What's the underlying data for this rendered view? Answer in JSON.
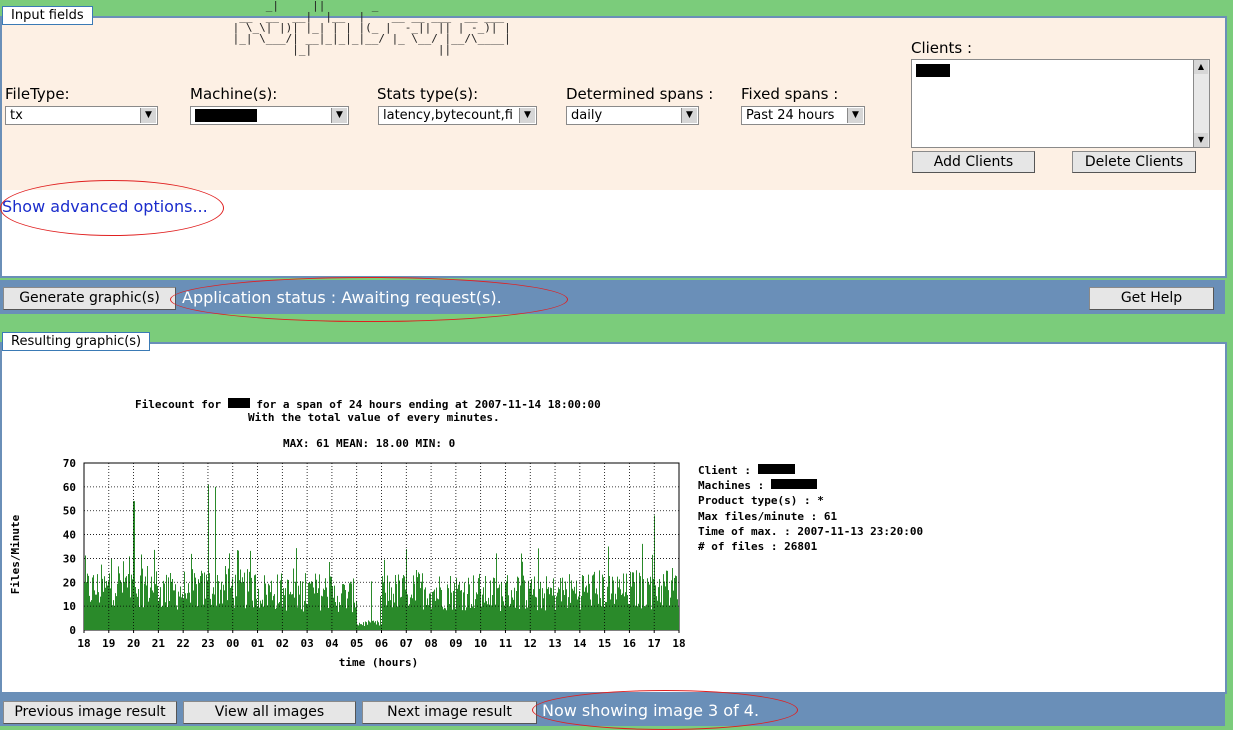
{
  "input_panel": {
    "legend": "Input fields",
    "ascii_banner": "      _|     ||       _      \n  __  __  __|  |__  |    __ __ ___  __ ___\n | \\_\\| |)| |_| | | |(_ |  -_|| || | -_)| |\n |_| \\___/| __|_|_|_|__/ |_ \\__/ |__/\\____|\n          |_|                   ||\n",
    "filetype": {
      "label": "FileType:",
      "value": "tx"
    },
    "machines": {
      "label": "Machine(s):"
    },
    "stats_type": {
      "label": "Stats type(s):",
      "value": "latency,bytecount,fi"
    },
    "determined_spans": {
      "label": "Determined spans :",
      "value": "daily"
    },
    "fixed_spans": {
      "label": "Fixed spans :",
      "value": "Past 24 hours"
    },
    "clients": {
      "label": "Clients :",
      "add_label": "Add Clients",
      "delete_label": "Delete Clients"
    }
  },
  "advanced": {
    "link_text": "Show advanced options..."
  },
  "status_bar": {
    "generate_label": "Generate graphic(s)",
    "status_text": "Application status : Awaiting request(s).",
    "help_label": "Get Help"
  },
  "result_panel": {
    "legend": "Resulting graphic(s)",
    "title_prefix": "Filecount for",
    "title_suffix": "for a span of 24 hours ending at 2007-11-14 18:00:00",
    "subtitle": "With the total value of every minutes.",
    "stats": "MAX: 61  MEAN: 18.00 MIN: 0",
    "info": {
      "client_label": "Client :",
      "machines_label": "Machines :",
      "product_types": "Product type(s) : *",
      "max_files": "Max files/minute : 61",
      "time_of_max": "Time of max. : 2007-11-13 23:20:00",
      "num_files": "# of files : 26801"
    }
  },
  "nav_bar": {
    "prev_label": "Previous image result",
    "view_all_label": "View all images",
    "next_label": "Next image result",
    "showing_text": "Now showing image 3 of 4."
  },
  "chart_data": {
    "type": "bar",
    "xlabel": "time (hours)",
    "ylabel": "Files/Minute",
    "ylim": [
      0,
      70
    ],
    "yticks": [
      0,
      10,
      20,
      30,
      40,
      50,
      60,
      70
    ],
    "xticks": [
      "18",
      "19",
      "20",
      "21",
      "22",
      "23",
      "00",
      "01",
      "02",
      "03",
      "04",
      "05",
      "06",
      "07",
      "08",
      "09",
      "10",
      "11",
      "12",
      "13",
      "14",
      "15",
      "16",
      "17",
      "18"
    ],
    "grid": true,
    "color": "#2a8a2a",
    "hourly_mean": [
      19,
      22,
      21,
      18,
      19,
      20,
      19,
      18,
      17,
      18,
      16,
      3,
      18,
      19,
      18,
      18,
      17,
      18,
      17,
      18,
      19,
      18,
      19,
      20
    ],
    "peaks": [
      {
        "hour": 5.0,
        "value": 61
      },
      {
        "hour": 2.0,
        "value": 54
      },
      {
        "hour": 5.3,
        "value": 60
      },
      {
        "hour": 23.0,
        "value": 48
      }
    ]
  }
}
